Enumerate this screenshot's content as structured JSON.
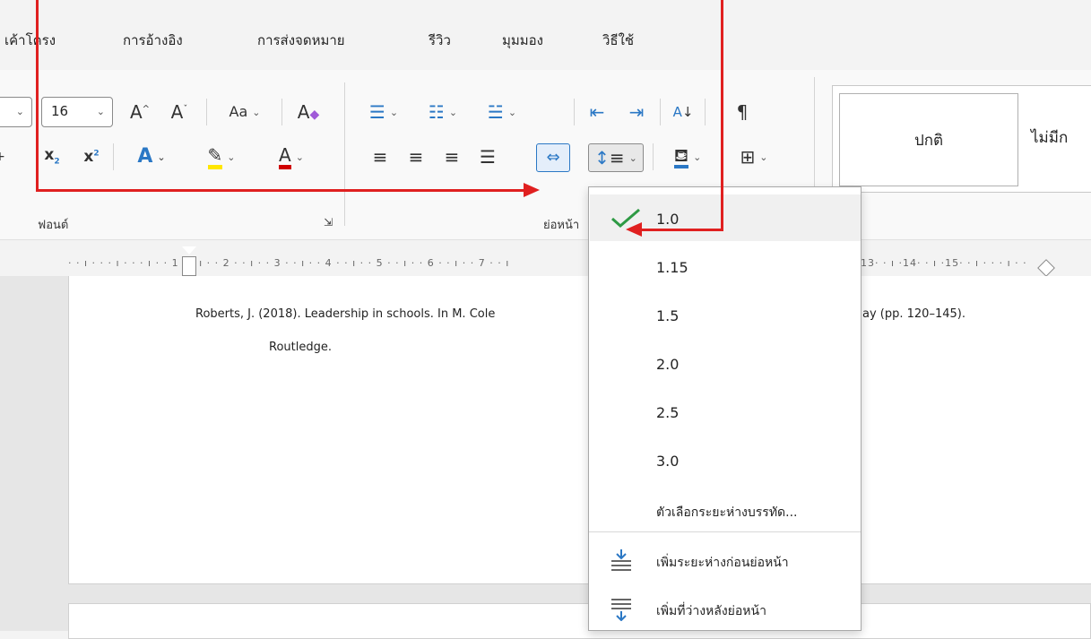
{
  "menu": {
    "tabs": [
      "เค้าโครง",
      "การอ้างอิง",
      "การส่งจดหมาย",
      "รีวิว",
      "มุมมอง",
      "วิธีใช้"
    ]
  },
  "ribbon": {
    "font_size": "16",
    "group_font_label": "ฟอนต์",
    "group_paragraph_label": "ย่อหน้า",
    "style_normal": "ปกติ",
    "style_no_spacing": "ไม่มีก"
  },
  "ruler": {
    "marks": "· · ı · · · ı · · · ı · · 1 · · ı · · 2 · · ı · · 3 · · ı · · 4 · · ı · · 5 · · ı · · 6 · · ı · · 7 · · ı",
    "marks_right": "13· · ı ·14· · ı ·15· · ı · · · ı · ·"
  },
  "document": {
    "line1_left": "Roberts, J. (2018). Leadership in schools. In M. Cole",
    "line1_right": "ay (pp. 120–145).",
    "line2": "Routledge."
  },
  "spacing_menu": {
    "options": [
      "1.0",
      "1.15",
      "1.5",
      "2.0",
      "2.5",
      "3.0"
    ],
    "selected": "1.0",
    "line_spacing_options": "ตัวเลือกระยะห่างบรรทัด...",
    "add_space_before": "เพิ่มระยะห่างก่อนย่อหน้า",
    "add_space_after": "เพิ่มที่ว่างหลังย่อหน้า"
  },
  "colors": {
    "annotation_red": "#e02020",
    "check_green": "#2e9a44",
    "highlight_yellow": "#ffe600",
    "font_color_red": "#d00000",
    "accent_blue": "#2b78c5"
  }
}
